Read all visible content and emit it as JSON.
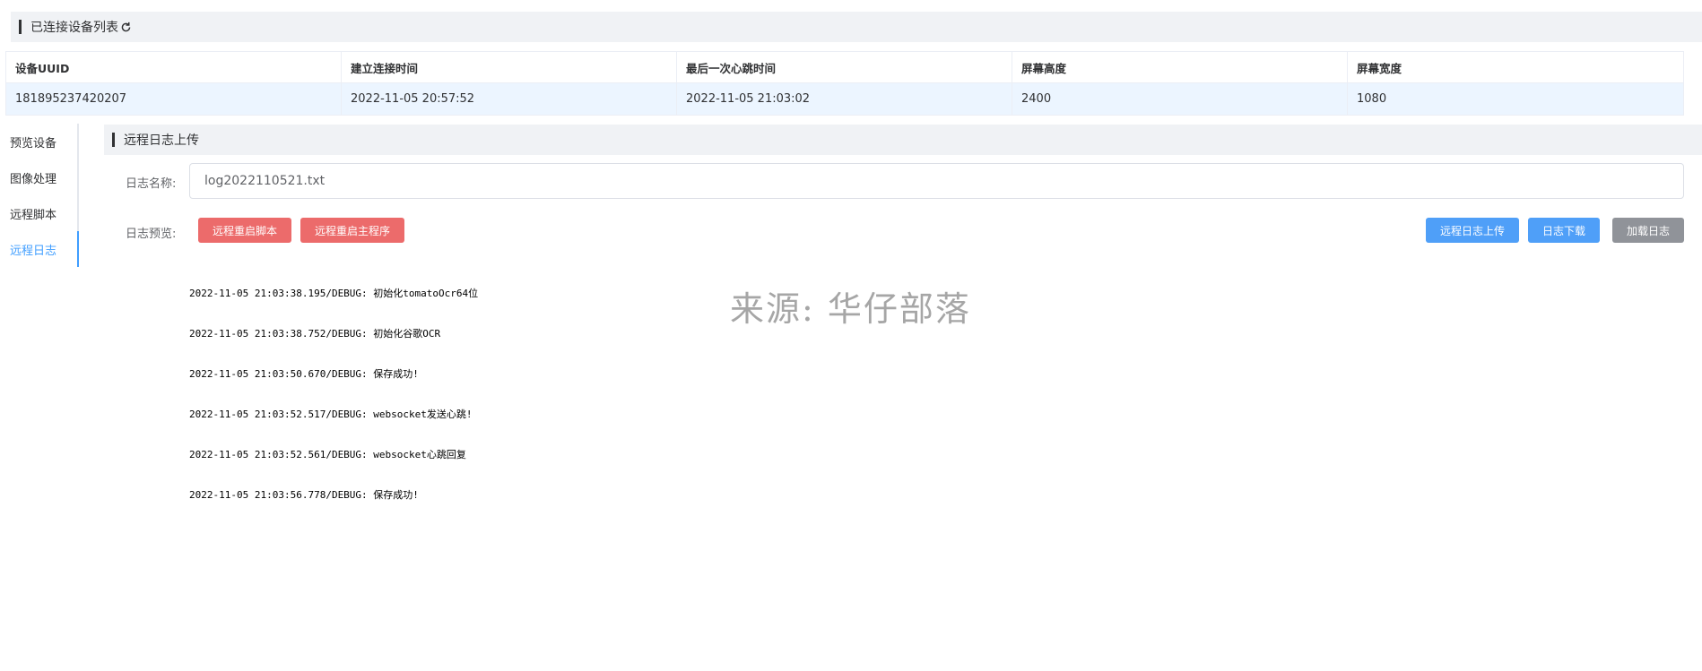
{
  "devices_panel": {
    "title": "已连接设备列表",
    "refresh_icon": "refresh-icon"
  },
  "device_table": {
    "columns": [
      "设备UUID",
      "建立连接时间",
      "最后一次心跳时间",
      "屏幕高度",
      "屏幕宽度"
    ],
    "rows": [
      [
        "181895237420207",
        "2022-11-05 20:57:52",
        "2022-11-05 21:03:02",
        "2400",
        "1080"
      ]
    ]
  },
  "side_nav": {
    "items": [
      "预览设备",
      "图像处理",
      "远程脚本",
      "远程日志"
    ],
    "active_index": 3
  },
  "log_panel": {
    "title": "远程日志上传",
    "name_label": "日志名称:",
    "name_value": "log2022110521.txt",
    "preview_label": "日志预览:",
    "buttons": {
      "restart_script": "远程重启脚本",
      "restart_main": "远程重启主程序",
      "upload": "远程日志上传",
      "download": "日志下载",
      "load": "加载日志"
    },
    "log_lines": [
      "2022-11-05 21:03:38.195/DEBUG: 初始化tomatoOcr64位",
      "2022-11-05 21:03:38.752/DEBUG: 初始化谷歌OCR",
      "2022-11-05 21:03:50.670/DEBUG: 保存成功!",
      "2022-11-05 21:03:52.517/DEBUG: websocket发送心跳!",
      "2022-11-05 21:03:52.561/DEBUG: websocket心跳回复",
      "2022-11-05 21:03:56.778/DEBUG: 保存成功!"
    ]
  },
  "watermark": "来源: 华仔部落",
  "colors": {
    "accent": "#409eff",
    "danger": "#ec6b6b",
    "primary_button": "#4f9ff8",
    "info_button": "#909399",
    "selected_row": "#ecf5ff",
    "header_bg": "#f0f2f5"
  }
}
